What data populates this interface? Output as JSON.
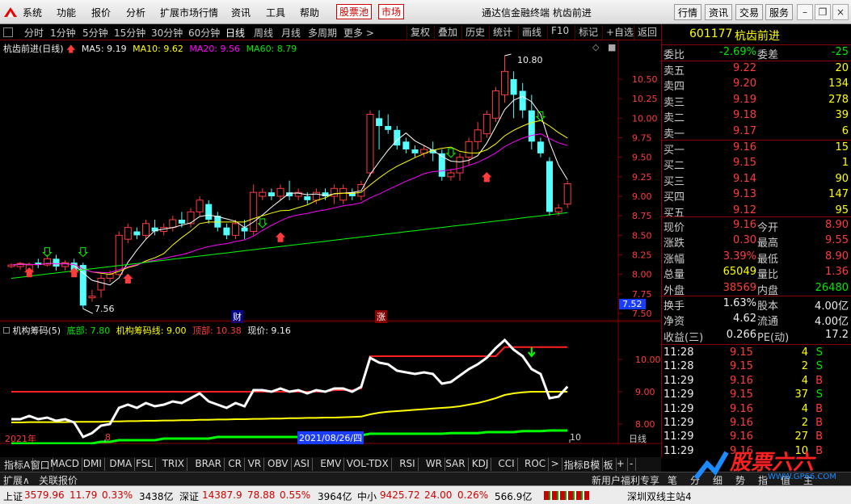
{
  "menu": {
    "items": [
      "系统",
      "功能",
      "报价",
      "分析",
      "扩展市场行情",
      "资讯",
      "工具",
      "帮助"
    ],
    "stock_pool": "股票池",
    "market": "市场",
    "app_title": "通达信金融终端",
    "stock_name_title": "杭齿前进",
    "right_buttons": [
      "行情",
      "资讯",
      "交易",
      "服务"
    ],
    "win_buttons": [
      "minimize-icon",
      "restore-icon",
      "close-icon"
    ]
  },
  "periods": [
    "分时",
    "1分钟",
    "5分钟",
    "15分钟",
    "30分钟",
    "60分钟",
    "日线",
    "周线",
    "月线",
    "多周期",
    "更多 >"
  ],
  "active_period": "日线",
  "tools": [
    "复权",
    "叠加",
    "历史",
    "统计",
    "画线",
    "F10",
    "标记",
    "+自选",
    "返回"
  ],
  "main_legend": {
    "title": "杭齿前进(日线)",
    "ma5": "MA5: 9.19",
    "ma10": "MA10: 9.62",
    "ma20": "MA20: 9.56",
    "ma60": "MA60: 8.79"
  },
  "price_axis": [
    "10.50",
    "10.25",
    "10.00",
    "9.75",
    "9.50",
    "9.25",
    "9.00",
    "8.75",
    "8.50",
    "8.25",
    "8.00",
    "7.75",
    "7.50"
  ],
  "price_tag": "7.52",
  "high_label": "10.80",
  "low_label": "7.56",
  "event_tags": {
    "cai": "财",
    "zhang": "涨"
  },
  "ind_legend": {
    "name": "机构筹码(5)",
    "bottom": "底部: 7.80",
    "line": "机构筹码线: 9.00",
    "top": "顶部: 10.38",
    "price": "现价: 9.16"
  },
  "ind_axis": [
    "10.00",
    "9.00",
    "8.00"
  ],
  "date_axis": {
    "year": "2021年",
    "m8": "8",
    "cursor": "2021/08/26/四",
    "m10": "10",
    "period": "日线"
  },
  "chart_data": [
    {
      "type": "candlestick",
      "title": "杭齿前进(日线)",
      "ylim": [
        7.5,
        10.9
      ],
      "candles": [
        [
          8.1,
          8.12,
          8.08,
          8.14
        ],
        [
          8.1,
          8.14,
          8.06,
          8.16
        ],
        [
          8.05,
          8.12,
          8.0,
          8.15
        ],
        [
          8.15,
          8.12,
          8.08,
          8.2
        ],
        [
          8.12,
          8.2,
          8.1,
          8.25
        ],
        [
          8.2,
          8.1,
          8.05,
          8.25
        ],
        [
          8.1,
          8.15,
          8.05,
          8.18
        ],
        [
          8.15,
          8.05,
          8.0,
          8.2
        ],
        [
          8.12,
          7.6,
          7.56,
          8.15
        ],
        [
          7.7,
          7.72,
          7.65,
          7.8
        ],
        [
          7.8,
          7.95,
          7.7,
          8.0
        ],
        [
          7.95,
          8.0,
          7.9,
          8.05
        ],
        [
          8.0,
          8.5,
          7.98,
          8.55
        ],
        [
          8.45,
          8.6,
          8.4,
          8.65
        ],
        [
          8.55,
          8.5,
          8.45,
          8.6
        ],
        [
          8.5,
          8.65,
          8.45,
          8.7
        ],
        [
          8.6,
          8.55,
          8.5,
          8.7
        ],
        [
          8.55,
          8.6,
          8.5,
          8.65
        ],
        [
          8.6,
          8.7,
          8.55,
          8.75
        ],
        [
          8.7,
          8.65,
          8.6,
          8.8
        ],
        [
          8.65,
          8.8,
          8.6,
          8.85
        ],
        [
          8.8,
          8.95,
          8.75,
          9.0
        ],
        [
          8.9,
          8.7,
          8.65,
          8.95
        ],
        [
          8.75,
          8.6,
          8.55,
          8.8
        ],
        [
          8.6,
          8.5,
          8.45,
          8.65
        ],
        [
          8.5,
          8.65,
          8.45,
          8.7
        ],
        [
          8.6,
          8.55,
          8.45,
          8.7
        ],
        [
          8.55,
          9.05,
          8.5,
          9.15
        ],
        [
          9.0,
          9.05,
          8.95,
          9.1
        ],
        [
          9.05,
          9.0,
          8.95,
          9.1
        ],
        [
          9.0,
          9.1,
          8.95,
          9.15
        ],
        [
          9.05,
          9.0,
          8.95,
          9.2
        ],
        [
          9.0,
          9.05,
          8.95,
          9.1
        ],
        [
          9.0,
          8.95,
          8.9,
          9.05
        ],
        [
          8.95,
          9.05,
          8.9,
          9.1
        ],
        [
          9.05,
          9.0,
          8.95,
          9.1
        ],
        [
          9.0,
          9.1,
          8.9,
          9.15
        ],
        [
          8.95,
          9.1,
          8.9,
          9.15
        ],
        [
          9.05,
          9.0,
          8.95,
          9.1
        ],
        [
          9.0,
          9.15,
          8.95,
          9.2
        ],
        [
          9.3,
          10.05,
          9.25,
          10.1
        ],
        [
          10.0,
          9.9,
          9.6,
          10.1
        ],
        [
          9.9,
          9.85,
          9.8,
          10.05
        ],
        [
          9.85,
          9.65,
          9.6,
          9.9
        ],
        [
          9.7,
          9.6,
          9.55,
          9.75
        ],
        [
          9.6,
          9.55,
          9.5,
          9.65
        ],
        [
          9.55,
          9.6,
          9.5,
          9.65
        ],
        [
          9.6,
          9.55,
          9.45,
          9.7
        ],
        [
          9.55,
          9.25,
          9.2,
          9.6
        ],
        [
          9.25,
          9.3,
          9.2,
          9.35
        ],
        [
          9.3,
          9.5,
          9.2,
          9.55
        ],
        [
          9.5,
          9.7,
          9.4,
          9.75
        ],
        [
          9.7,
          9.85,
          9.6,
          9.95
        ],
        [
          9.8,
          10.05,
          9.75,
          10.1
        ],
        [
          10.0,
          10.35,
          9.95,
          10.4
        ],
        [
          10.3,
          10.6,
          10.2,
          10.8
        ],
        [
          10.5,
          10.3,
          10.0,
          10.6
        ],
        [
          10.35,
          10.1,
          10.0,
          10.45
        ],
        [
          10.1,
          9.7,
          9.6,
          10.3
        ],
        [
          9.7,
          9.55,
          9.5,
          9.75
        ],
        [
          9.45,
          8.8,
          8.75,
          9.5
        ],
        [
          8.8,
          8.85,
          8.75,
          8.9
        ],
        [
          8.9,
          9.16,
          8.85,
          9.2
        ]
      ],
      "series": [
        {
          "name": "MA5",
          "color": "#ffffff"
        },
        {
          "name": "MA10",
          "color": "#ffff00"
        },
        {
          "name": "MA20",
          "color": "#ff00ff"
        },
        {
          "name": "MA60",
          "color": "#00ff00"
        }
      ]
    },
    {
      "type": "line",
      "title": "机构筹码(5)",
      "ylim": [
        7.5,
        10.7
      ],
      "series": [
        {
          "name": "机构筹码线",
          "color": "#ffff00",
          "values": [
            8.05,
            8.05,
            8.06,
            8.06,
            8.06,
            8.06,
            8.06,
            8.07,
            8.07,
            8.07,
            8.07,
            8.08,
            8.08,
            8.09,
            8.09,
            8.1,
            8.1,
            8.11,
            8.11,
            8.12,
            8.12,
            8.13,
            8.13,
            8.14,
            8.14,
            8.15,
            8.15,
            8.16,
            8.16,
            8.17,
            8.17,
            8.18,
            8.18,
            8.19,
            8.19,
            8.2,
            8.2,
            8.21,
            8.22,
            8.23,
            8.3,
            8.35,
            8.38,
            8.4,
            8.42,
            8.44,
            8.46,
            8.48,
            8.5,
            8.52,
            8.55,
            8.6,
            8.65,
            8.72,
            8.8,
            8.9,
            8.95,
            8.98,
            9.0,
            9.0,
            9.0,
            9.0,
            9.0
          ]
        },
        {
          "name": "顶部",
          "color": "#ff2020",
          "values": [
            9.0,
            9.0,
            9.0,
            9.0,
            9.0,
            9.0,
            9.0,
            9.0,
            9.0,
            9.0,
            9.0,
            9.0,
            9.0,
            9.0,
            9.0,
            9.0,
            9.0,
            9.0,
            9.0,
            9.0,
            9.0,
            9.0,
            9.0,
            9.0,
            9.0,
            9.0,
            9.0,
            9.0,
            9.0,
            9.0,
            9.0,
            9.0,
            9.0,
            9.0,
            9.0,
            9.0,
            9.05,
            9.05,
            9.05,
            9.1,
            10.1,
            10.1,
            10.1,
            10.1,
            10.1,
            10.1,
            10.1,
            10.1,
            10.1,
            10.1,
            10.1,
            10.1,
            10.1,
            10.1,
            10.1,
            10.38,
            10.38,
            10.38,
            10.38,
            10.38,
            10.38,
            10.38,
            10.38
          ]
        },
        {
          "name": "底部",
          "color": "#00ff00",
          "values": [
            7.4,
            7.4,
            7.4,
            7.4,
            7.4,
            7.4,
            7.4,
            7.4,
            7.4,
            7.4,
            7.45,
            7.45,
            7.5,
            7.5,
            7.5,
            7.5,
            7.5,
            7.55,
            7.55,
            7.55,
            7.55,
            7.55,
            7.55,
            7.6,
            7.6,
            7.6,
            7.6,
            7.6,
            7.6,
            7.6,
            7.6,
            7.6,
            7.6,
            7.65,
            7.65,
            7.65,
            7.65,
            7.65,
            7.65,
            7.65,
            7.7,
            7.7,
            7.7,
            7.7,
            7.7,
            7.7,
            7.7,
            7.7,
            7.7,
            7.72,
            7.72,
            7.72,
            7.72,
            7.75,
            7.75,
            7.75,
            7.75,
            7.78,
            7.78,
            7.78,
            7.8,
            7.8,
            7.8
          ]
        },
        {
          "name": "现价",
          "color": "#ffffff",
          "values": [
            8.15,
            8.15,
            8.25,
            8.15,
            8.2,
            8.1,
            8.15,
            8.05,
            7.6,
            7.72,
            7.95,
            8.0,
            8.5,
            8.6,
            8.5,
            8.65,
            8.55,
            8.6,
            8.7,
            8.65,
            8.8,
            8.95,
            8.7,
            8.6,
            8.5,
            8.65,
            8.55,
            9.05,
            9.05,
            9.0,
            9.1,
            9.0,
            9.05,
            8.95,
            9.05,
            9.0,
            9.1,
            9.1,
            9.0,
            9.15,
            10.05,
            9.9,
            9.85,
            9.65,
            9.6,
            9.55,
            9.6,
            9.55,
            9.25,
            9.3,
            9.5,
            9.7,
            9.85,
            10.05,
            10.35,
            10.6,
            10.3,
            10.1,
            9.7,
            9.55,
            8.8,
            8.85,
            9.16
          ]
        }
      ]
    }
  ],
  "quote": {
    "code": "601177",
    "name": "杭齿前进",
    "weibi_label": "委比",
    "weibi": "-2.69%",
    "weicha_label": "委差",
    "weicha": "-25",
    "asks": [
      {
        "label": "卖五",
        "price": "9.22",
        "vol": "20"
      },
      {
        "label": "卖四",
        "price": "9.20",
        "vol": "134"
      },
      {
        "label": "卖三",
        "price": "9.19",
        "vol": "278"
      },
      {
        "label": "卖二",
        "price": "9.18",
        "vol": "39"
      },
      {
        "label": "卖一",
        "price": "9.17",
        "vol": "6"
      }
    ],
    "bids": [
      {
        "label": "买一",
        "price": "9.16",
        "vol": "15"
      },
      {
        "label": "买二",
        "price": "9.15",
        "vol": "1"
      },
      {
        "label": "买三",
        "price": "9.14",
        "vol": "90"
      },
      {
        "label": "买四",
        "price": "9.13",
        "vol": "147"
      },
      {
        "label": "买五",
        "price": "9.12",
        "vol": "95"
      }
    ],
    "stats": [
      {
        "l1": "现价",
        "v1": "9.16",
        "c1": "red",
        "l2": "今开",
        "v2": "8.90",
        "c2": "red"
      },
      {
        "l1": "涨跌",
        "v1": "0.30",
        "c1": "red",
        "l2": "最高",
        "v2": "9.55",
        "c2": "red"
      },
      {
        "l1": "涨幅",
        "v1": "3.39%",
        "c1": "red",
        "l2": "最低",
        "v2": "8.90",
        "c2": "red"
      },
      {
        "l1": "总量",
        "v1": "65049",
        "c1": "yellow",
        "l2": "量比",
        "v2": "1.36",
        "c2": "red"
      },
      {
        "l1": "外盘",
        "v1": "38569",
        "c1": "red",
        "l2": "内盘",
        "v2": "26480",
        "c2": "green"
      }
    ],
    "fin": [
      {
        "l1": "换手",
        "v1": "1.63%",
        "l2": "股本",
        "v2": "4.00亿"
      },
      {
        "l1": "净资",
        "v1": "4.62",
        "l2": "流通",
        "v2": "4.00亿"
      },
      {
        "l1": "收益(三)",
        "v1": "0.266",
        "l2": "PE(动)",
        "v2": "17.2"
      }
    ],
    "ticks": [
      {
        "t": "11:28",
        "p": "9.15",
        "v": "4",
        "s": "S"
      },
      {
        "t": "11:28",
        "p": "9.15",
        "v": "2",
        "s": "S"
      },
      {
        "t": "11:29",
        "p": "9.16",
        "v": "4",
        "s": "B"
      },
      {
        "t": "11:29",
        "p": "9.15",
        "v": "37",
        "s": "S"
      },
      {
        "t": "11:29",
        "p": "9.16",
        "v": "4",
        "s": "B"
      },
      {
        "t": "11:29",
        "p": "9.16",
        "v": "2",
        "s": "B"
      },
      {
        "t": "11:29",
        "p": "9.16",
        "v": "27",
        "s": "B"
      },
      {
        "t": "11:29",
        "p": "9.16",
        "v": "10",
        "s": "B"
      }
    ]
  },
  "ind_tabs": [
    "指标A",
    "窗口",
    "MACD",
    "DMI",
    "DMA",
    "FSL",
    "TRIX",
    "BRAR",
    "CR",
    "VR",
    "OBV",
    "ASI",
    "EMV",
    "VOL-TDX",
    "RSI",
    "WR",
    "SAR",
    "KDJ",
    "CCI",
    "ROC",
    ">",
    "指标B",
    "模",
    "板",
    "+",
    "-"
  ],
  "bottom_tabs": {
    "left": [
      "扩展∧",
      "关联报价"
    ],
    "news": "新用户福利专享",
    "right": [
      "笔",
      "分",
      "细",
      "势",
      "指",
      "值",
      "主"
    ]
  },
  "status": {
    "sh_label": "上证",
    "sh_val": "3579.96",
    "sh_chg": "11.79",
    "sh_pct": "0.33%",
    "sh_amt": "3438亿",
    "sz_label": "深证",
    "sz_val": "14387.9",
    "sz_chg": "78.88",
    "sz_pct": "0.55%",
    "sz_amt": "3964亿",
    "zx_label": "中小",
    "zx_val": "9425.72",
    "zx_chg": "24.00",
    "zx_pct": "0.26%",
    "zx_amt": "566.9亿",
    "right": "深圳双线主站4"
  },
  "watermark": {
    "text": "股票六六",
    "url": "WWW.GP66.COM"
  }
}
